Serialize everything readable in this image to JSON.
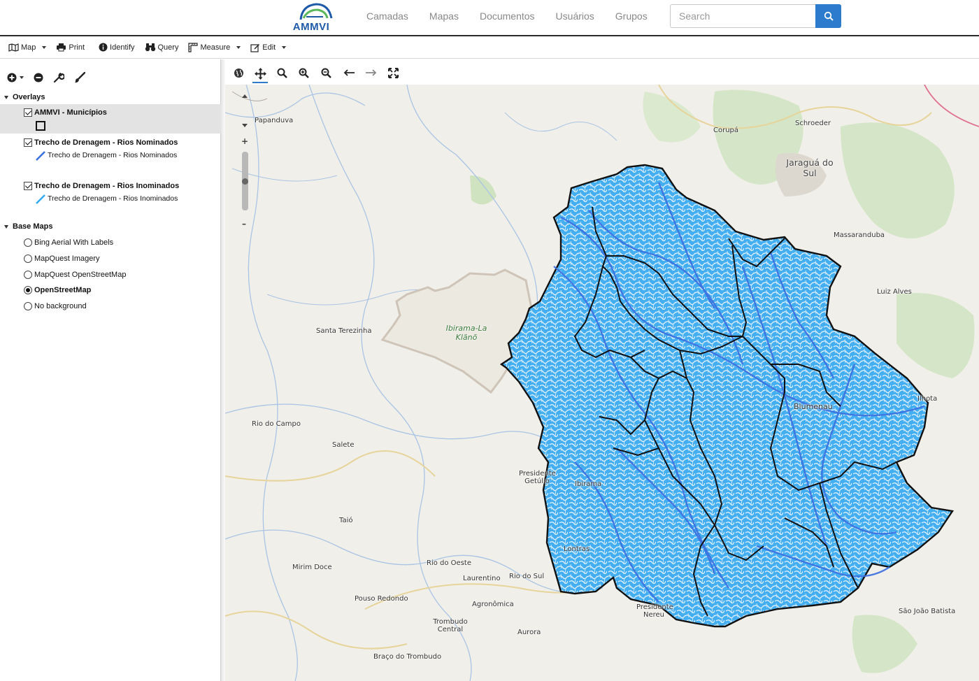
{
  "header": {
    "logo_text": "AMMVI",
    "nav": [
      "Camadas",
      "Mapas",
      "Documentos",
      "Usuários",
      "Grupos"
    ],
    "search_placeholder": "Search"
  },
  "toolbar": {
    "map": "Map",
    "print": "Print",
    "identify": "Identify",
    "query": "Query",
    "measure": "Measure",
    "edit": "Edit"
  },
  "layers": {
    "overlays_title": "Overlays",
    "items": [
      {
        "title": "AMMVI - Municípios",
        "legend": ""
      },
      {
        "title": "Trecho de Drenagem - Rios Nominados",
        "legend": "Trecho de Drenagem - Rios Nominados",
        "color": "#3a6fe0"
      },
      {
        "title": "Trecho de Drenagem - Rios Inominados",
        "legend": "Trecho de Drenagem - Rios Inominados",
        "color": "#32aaf0"
      }
    ],
    "basemaps_title": "Base Maps",
    "basemaps": [
      "Bing Aerial With Labels",
      "MapQuest Imagery",
      "MapQuest OpenStreetMap",
      "OpenStreetMap",
      "No background"
    ],
    "selected_basemap": "OpenStreetMap"
  },
  "map": {
    "places": {
      "papanduva": "Papanduva",
      "corupa": "Corupá",
      "schroeder": "Schroeder",
      "jaragua": "Jaraguá do Sul",
      "massaranduba": "Massaranduba",
      "luiz_alves": "Luiz Alves",
      "santa_terezinha": "Santa Terezinha",
      "ibirama_la": "Ibirama-La Klãnõ",
      "rio_do_campo": "Rio do Campo",
      "salete": "Salete",
      "presidente_getulio": "Presidente Getúlio",
      "ibirama": "Ibirama",
      "taio": "Taió",
      "lontras": "Lontras",
      "mirim_doce": "Mirim Doce",
      "rio_do_oeste": "Rio do Oeste",
      "laurentino": "Laurentino",
      "rio_do_sul": "Rio do Sul",
      "pouso_redondo": "Pouso Redondo",
      "agronomica": "Agronômica",
      "presidente_nereu": "Presidente Nereu",
      "trombudo_central": "Trombudo Central",
      "aurora": "Aurora",
      "braco_do_trombudo": "Braço do Trombudo",
      "ilhota": "Ilhota",
      "sao_joao_batista": "São João Batista",
      "blumenau": "Blumenau"
    },
    "colors": {
      "base": "#f1efe9",
      "river_nominados": "#3a6fe0",
      "river_inominados": "#32aaf0",
      "boundary": "#111111",
      "forest": "#cfe3c0"
    }
  }
}
